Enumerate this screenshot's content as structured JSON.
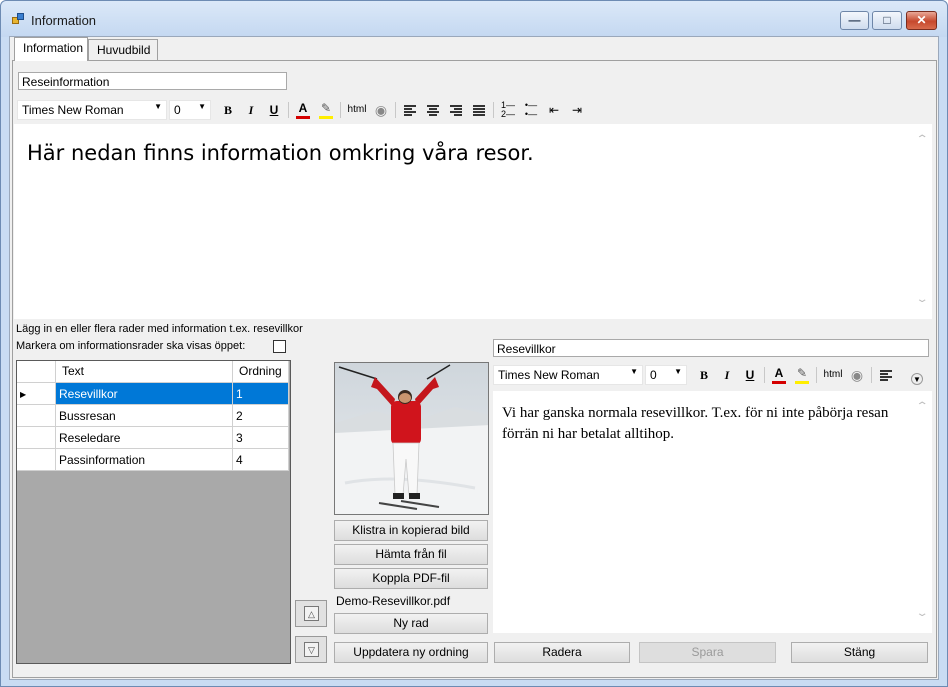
{
  "window": {
    "title": "Information"
  },
  "tabs": [
    {
      "label": "Information"
    },
    {
      "label": "Huvudbild"
    }
  ],
  "top_editor": {
    "title_value": "Reseinformation",
    "font": "Times New Roman",
    "size": "0",
    "text": "Här nedan finns information omkring våra resor."
  },
  "labels": {
    "instruction": "Lägg in en eller flera rader med information t.ex. resevillkor",
    "open_label": "Markera om informationsrader ska visas öppet:"
  },
  "grid": {
    "columns": [
      "Text",
      "Ordning"
    ],
    "rows": [
      {
        "text": "Resevillkor",
        "order": "1",
        "selected": true
      },
      {
        "text": "Bussresan",
        "order": "2",
        "selected": false
      },
      {
        "text": "Reseledare",
        "order": "3",
        "selected": false
      },
      {
        "text": "Passinformation",
        "order": "4",
        "selected": false
      }
    ]
  },
  "image_buttons": {
    "paste": "Klistra in kopierad bild",
    "fetch": "Hämta från fil",
    "pdf": "Koppla PDF-fil",
    "pdf_name": "Demo-Resevillkor.pdf",
    "new_row": "Ny rad",
    "update_order": "Uppdatera ny ordning"
  },
  "row_editor": {
    "title_value": "Resevillkor",
    "font": "Times New Roman",
    "size": "0",
    "text": "Vi har ganska normala resevillkor. T.ex. för ni inte påbörja resan förrän ni har betalat alltihop."
  },
  "toolbar": {
    "bold": "B",
    "italic": "I",
    "underline": "U",
    "font_color": "A",
    "html": "html"
  },
  "actions": {
    "delete": "Radera",
    "save": "Spara",
    "close": "Stäng"
  },
  "icons": [
    "app-icon",
    "minimize-icon",
    "maximize-icon",
    "close-icon",
    "bold-icon",
    "italic-icon",
    "underline-icon",
    "font-color-icon",
    "highlight-icon",
    "html-icon",
    "web-icon",
    "align-left-icon",
    "align-center-icon",
    "align-right-icon",
    "justify-icon",
    "numbered-list-icon",
    "bullet-list-icon",
    "outdent-icon",
    "indent-icon",
    "move-up-icon",
    "move-down-icon",
    "row-pointer-icon"
  ],
  "colors": {
    "selection": "#0078d7",
    "font_color_bar": "#d40000",
    "highlight_bar": "#ffee00",
    "title_gradient_top": "#dbe8f8"
  }
}
